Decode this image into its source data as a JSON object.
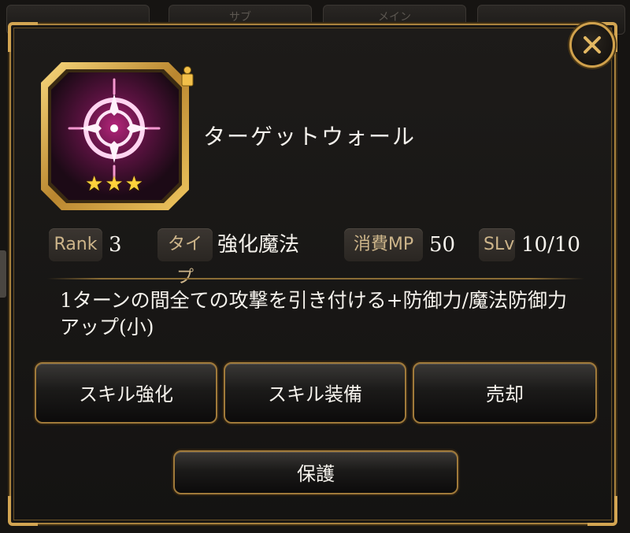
{
  "background_tabs": [
    "サブ",
    "メイン"
  ],
  "dialog": {
    "close_icon": "close-x-icon",
    "skill": {
      "name": "ターゲットウォール",
      "stars": "★★★",
      "rarity_stars": 3,
      "icon": "target-wall-magic-icon",
      "lock_icon": "lock-badge-icon",
      "stats": [
        {
          "label": "Rank",
          "value": "3"
        },
        {
          "label": "タイプ",
          "value": "強化魔法"
        },
        {
          "label": "消費MP",
          "value": "50"
        },
        {
          "label": "SLv",
          "value": "10/10"
        }
      ],
      "description": "1ターンの間全ての攻撃を引き付ける+防御力/魔法防御力アップ(小)"
    },
    "buttons": {
      "enhance": "スキル強化",
      "equip": "スキル装備",
      "sell": "売却",
      "protect": "保護"
    }
  },
  "colors": {
    "frame_gold": "#a9823e",
    "icon_magenta": "#e0339f",
    "star_gold": "#ffd23c",
    "tag_text": "#cdb58a"
  }
}
